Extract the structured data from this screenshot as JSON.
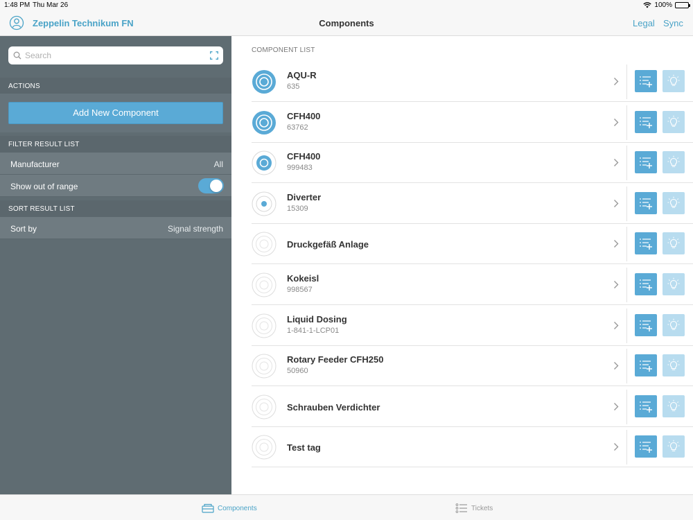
{
  "status_bar": {
    "time": "1:48 PM",
    "date": "Thu Mar 26",
    "battery": "100%"
  },
  "nav": {
    "app_title": "Zeppelin Technikum FN",
    "page_title": "Components",
    "legal": "Legal",
    "sync": "Sync"
  },
  "sidebar": {
    "search_placeholder": "Search",
    "actions_header": "ACTIONS",
    "add_button": "Add New Component",
    "filter_header": "FILTER RESULT LIST",
    "manufacturer_label": "Manufacturer",
    "manufacturer_value": "All",
    "out_of_range_label": "Show out of range",
    "sort_header": "SORT RESULT LIST",
    "sort_label": "Sort by",
    "sort_value": "Signal strength"
  },
  "main": {
    "list_header": "COMPONENT LIST",
    "components": [
      {
        "name": "AQU-R",
        "id": "635",
        "signal": "strong"
      },
      {
        "name": "CFH400",
        "id": "63762",
        "signal": "strong"
      },
      {
        "name": "CFH400",
        "id": "999483",
        "signal": "medium"
      },
      {
        "name": "Diverter",
        "id": "15309",
        "signal": "weak"
      },
      {
        "name": "Druckgefäß Anlage",
        "id": "",
        "signal": "none"
      },
      {
        "name": "Kokeisl",
        "id": "998567",
        "signal": "none"
      },
      {
        "name": "Liquid Dosing",
        "id": "1-841-1-LCP01",
        "signal": "none"
      },
      {
        "name": "Rotary Feeder CFH250",
        "id": "50960",
        "signal": "none"
      },
      {
        "name": "Schrauben Verdichter",
        "id": "",
        "signal": "none"
      },
      {
        "name": "Test tag",
        "id": "",
        "signal": "none"
      }
    ]
  },
  "tabs": {
    "components": "Components",
    "tickets": "Tickets"
  },
  "colors": {
    "accent": "#4aa3c7",
    "button": "#5aaad6",
    "sidebar": "#5f6c72"
  }
}
